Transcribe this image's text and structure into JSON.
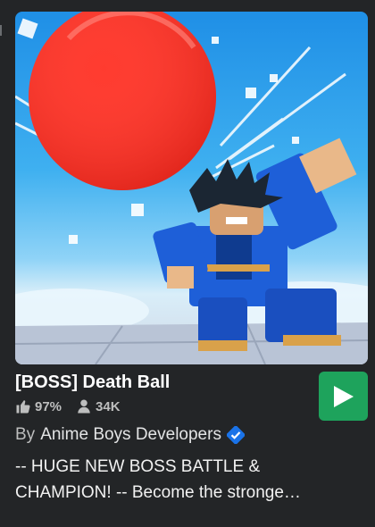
{
  "game": {
    "title": "[BOSS] Death Ball",
    "like_ratio": "97%",
    "player_count": "34K",
    "creator_prefix": "By",
    "creator_name": "Anime Boys Developers",
    "description_line1": "-- HUGE NEW BOSS BATTLE &",
    "description_line2": "CHAMPION! -- Become the stronge…"
  },
  "icons": {
    "like": "thumbs-up-icon",
    "players": "person-icon",
    "play": "play-icon",
    "verified": "verified-badge-icon"
  },
  "colors": {
    "background": "#232527",
    "play_button": "#1ea35c",
    "verified": "#1a73e8"
  }
}
